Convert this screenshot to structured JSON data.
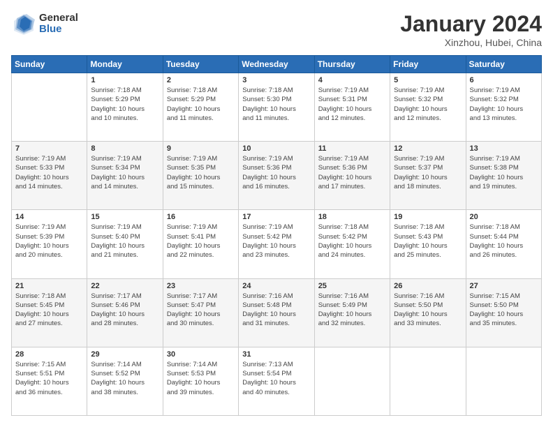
{
  "logo": {
    "general": "General",
    "blue": "Blue"
  },
  "title": "January 2024",
  "subtitle": "Xinzhou, Hubei, China",
  "days_header": [
    "Sunday",
    "Monday",
    "Tuesday",
    "Wednesday",
    "Thursday",
    "Friday",
    "Saturday"
  ],
  "weeks": [
    [
      {
        "day": "",
        "info": ""
      },
      {
        "day": "1",
        "info": "Sunrise: 7:18 AM\nSunset: 5:29 PM\nDaylight: 10 hours\nand 10 minutes."
      },
      {
        "day": "2",
        "info": "Sunrise: 7:18 AM\nSunset: 5:29 PM\nDaylight: 10 hours\nand 11 minutes."
      },
      {
        "day": "3",
        "info": "Sunrise: 7:18 AM\nSunset: 5:30 PM\nDaylight: 10 hours\nand 11 minutes."
      },
      {
        "day": "4",
        "info": "Sunrise: 7:19 AM\nSunset: 5:31 PM\nDaylight: 10 hours\nand 12 minutes."
      },
      {
        "day": "5",
        "info": "Sunrise: 7:19 AM\nSunset: 5:32 PM\nDaylight: 10 hours\nand 12 minutes."
      },
      {
        "day": "6",
        "info": "Sunrise: 7:19 AM\nSunset: 5:32 PM\nDaylight: 10 hours\nand 13 minutes."
      }
    ],
    [
      {
        "day": "7",
        "info": "Sunrise: 7:19 AM\nSunset: 5:33 PM\nDaylight: 10 hours\nand 14 minutes."
      },
      {
        "day": "8",
        "info": "Sunrise: 7:19 AM\nSunset: 5:34 PM\nDaylight: 10 hours\nand 14 minutes."
      },
      {
        "day": "9",
        "info": "Sunrise: 7:19 AM\nSunset: 5:35 PM\nDaylight: 10 hours\nand 15 minutes."
      },
      {
        "day": "10",
        "info": "Sunrise: 7:19 AM\nSunset: 5:36 PM\nDaylight: 10 hours\nand 16 minutes."
      },
      {
        "day": "11",
        "info": "Sunrise: 7:19 AM\nSunset: 5:36 PM\nDaylight: 10 hours\nand 17 minutes."
      },
      {
        "day": "12",
        "info": "Sunrise: 7:19 AM\nSunset: 5:37 PM\nDaylight: 10 hours\nand 18 minutes."
      },
      {
        "day": "13",
        "info": "Sunrise: 7:19 AM\nSunset: 5:38 PM\nDaylight: 10 hours\nand 19 minutes."
      }
    ],
    [
      {
        "day": "14",
        "info": "Sunrise: 7:19 AM\nSunset: 5:39 PM\nDaylight: 10 hours\nand 20 minutes."
      },
      {
        "day": "15",
        "info": "Sunrise: 7:19 AM\nSunset: 5:40 PM\nDaylight: 10 hours\nand 21 minutes."
      },
      {
        "day": "16",
        "info": "Sunrise: 7:19 AM\nSunset: 5:41 PM\nDaylight: 10 hours\nand 22 minutes."
      },
      {
        "day": "17",
        "info": "Sunrise: 7:19 AM\nSunset: 5:42 PM\nDaylight: 10 hours\nand 23 minutes."
      },
      {
        "day": "18",
        "info": "Sunrise: 7:18 AM\nSunset: 5:42 PM\nDaylight: 10 hours\nand 24 minutes."
      },
      {
        "day": "19",
        "info": "Sunrise: 7:18 AM\nSunset: 5:43 PM\nDaylight: 10 hours\nand 25 minutes."
      },
      {
        "day": "20",
        "info": "Sunrise: 7:18 AM\nSunset: 5:44 PM\nDaylight: 10 hours\nand 26 minutes."
      }
    ],
    [
      {
        "day": "21",
        "info": "Sunrise: 7:18 AM\nSunset: 5:45 PM\nDaylight: 10 hours\nand 27 minutes."
      },
      {
        "day": "22",
        "info": "Sunrise: 7:17 AM\nSunset: 5:46 PM\nDaylight: 10 hours\nand 28 minutes."
      },
      {
        "day": "23",
        "info": "Sunrise: 7:17 AM\nSunset: 5:47 PM\nDaylight: 10 hours\nand 30 minutes."
      },
      {
        "day": "24",
        "info": "Sunrise: 7:16 AM\nSunset: 5:48 PM\nDaylight: 10 hours\nand 31 minutes."
      },
      {
        "day": "25",
        "info": "Sunrise: 7:16 AM\nSunset: 5:49 PM\nDaylight: 10 hours\nand 32 minutes."
      },
      {
        "day": "26",
        "info": "Sunrise: 7:16 AM\nSunset: 5:50 PM\nDaylight: 10 hours\nand 33 minutes."
      },
      {
        "day": "27",
        "info": "Sunrise: 7:15 AM\nSunset: 5:50 PM\nDaylight: 10 hours\nand 35 minutes."
      }
    ],
    [
      {
        "day": "28",
        "info": "Sunrise: 7:15 AM\nSunset: 5:51 PM\nDaylight: 10 hours\nand 36 minutes."
      },
      {
        "day": "29",
        "info": "Sunrise: 7:14 AM\nSunset: 5:52 PM\nDaylight: 10 hours\nand 38 minutes."
      },
      {
        "day": "30",
        "info": "Sunrise: 7:14 AM\nSunset: 5:53 PM\nDaylight: 10 hours\nand 39 minutes."
      },
      {
        "day": "31",
        "info": "Sunrise: 7:13 AM\nSunset: 5:54 PM\nDaylight: 10 hours\nand 40 minutes."
      },
      {
        "day": "",
        "info": ""
      },
      {
        "day": "",
        "info": ""
      },
      {
        "day": "",
        "info": ""
      }
    ]
  ]
}
